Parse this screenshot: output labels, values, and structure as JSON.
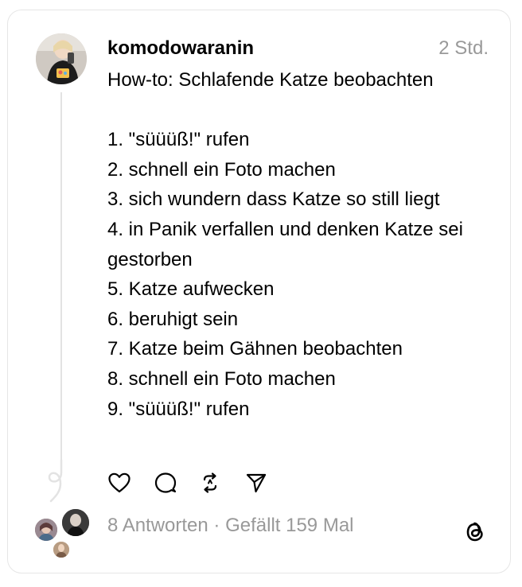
{
  "post": {
    "username": "komodowaranin",
    "time": "2 Std.",
    "title": "How-to: Schlafende Katze beobachten",
    "steps": [
      "1. \"süüüß!\" rufen",
      "2. schnell ein Foto machen",
      "3. sich wundern dass Katze so still liegt",
      "4. in Panik verfallen und denken Katze sei gestorben",
      "5. Katze aufwecken",
      "6. beruhigt sein",
      "7. Katze beim Gähnen beobachten",
      "8. schnell ein Foto machen",
      "9. \"süüüß!\" rufen"
    ]
  },
  "actions": {
    "icons": [
      "heart-icon",
      "comment-icon",
      "repost-icon",
      "share-icon"
    ]
  },
  "footer": {
    "replies": "8 Antworten",
    "separator": " · ",
    "likes": "Gefällt 159 Mal"
  },
  "colors": {
    "text": "#000000",
    "muted": "#999999",
    "thread_line": "#e3e3e3",
    "border": "#e6e6e6"
  }
}
